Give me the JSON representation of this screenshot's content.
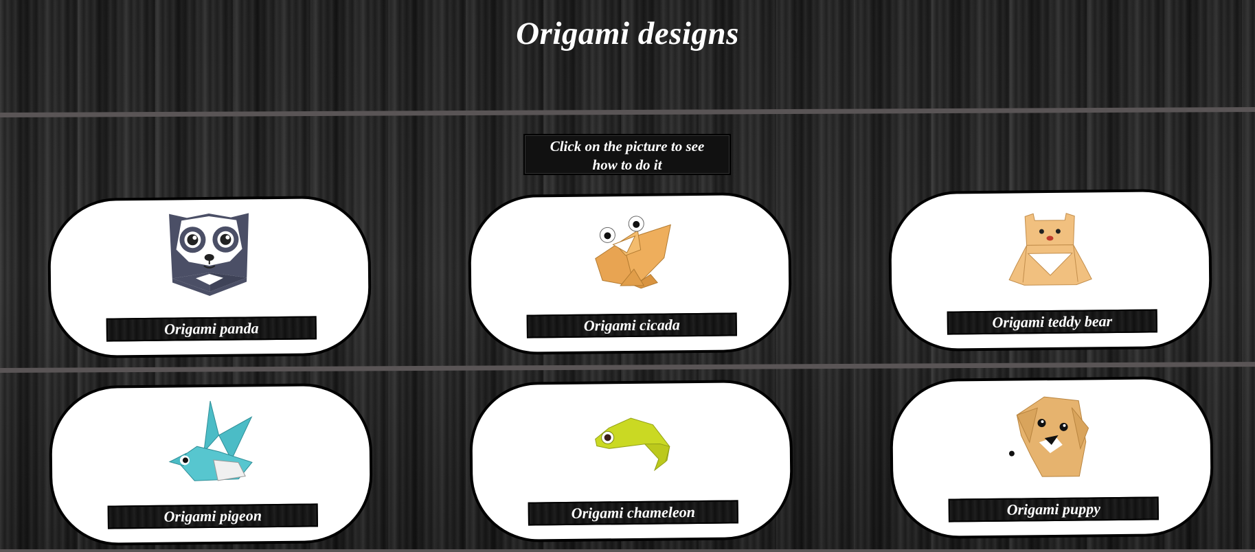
{
  "page": {
    "title": "Origami designs"
  },
  "hint": {
    "line1": "Click on the picture to see",
    "line2": "how to do it"
  },
  "cards": [
    {
      "label": "Origami panda",
      "icon": "panda-icon",
      "color": "#4b4f66"
    },
    {
      "label": "Origami cicada",
      "icon": "cicada-icon",
      "color": "#e8a452"
    },
    {
      "label": "Origami teddy bear",
      "icon": "teddy-bear-icon",
      "color": "#f1c07f"
    },
    {
      "label": "Origami pigeon",
      "icon": "pigeon-icon",
      "color": "#4bbcc6"
    },
    {
      "label": "Origami chameleon",
      "icon": "chameleon-icon",
      "color": "#cad923"
    },
    {
      "label": "Origami puppy",
      "icon": "puppy-icon",
      "color": "#e6b36e"
    }
  ]
}
